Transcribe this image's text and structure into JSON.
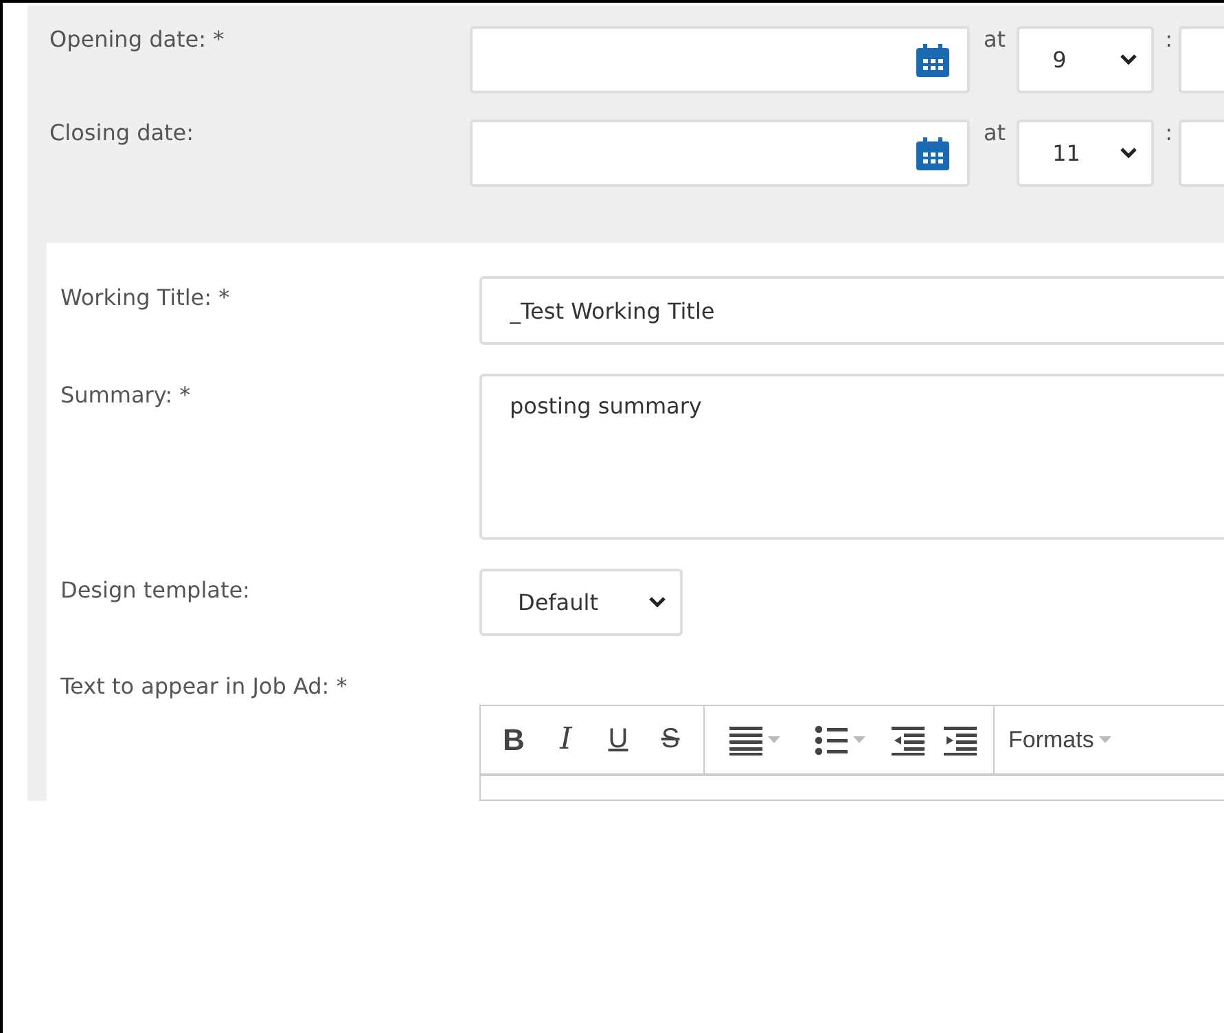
{
  "schedule": [
    {
      "label": "Opening date: *",
      "at": "at",
      "hour": "9",
      "separator": ":"
    },
    {
      "label": "Closing date:",
      "at": "at",
      "hour": "11",
      "separator": ":"
    }
  ],
  "fields": [
    {
      "kind": "text",
      "label": "Working Title: *",
      "value": "_Test Working Title"
    },
    {
      "kind": "textarea",
      "label": "Summary: *",
      "value": "posting summary"
    },
    {
      "kind": "select",
      "label": "Design template:",
      "value": "Default"
    },
    {
      "kind": "editor",
      "label": "Text to appear in Job Ad: *"
    }
  ],
  "editor_toolbar": [
    [
      {
        "kind": "bold",
        "text": "B"
      },
      {
        "kind": "italic",
        "text": "I"
      },
      {
        "kind": "underline",
        "text": "U"
      },
      {
        "kind": "strike",
        "text": "S"
      }
    ],
    [
      {
        "kind": "align"
      },
      {
        "kind": "bullets"
      },
      {
        "kind": "outdent"
      },
      {
        "kind": "indent"
      }
    ],
    [
      {
        "kind": "formats",
        "text": "Formats"
      }
    ]
  ]
}
